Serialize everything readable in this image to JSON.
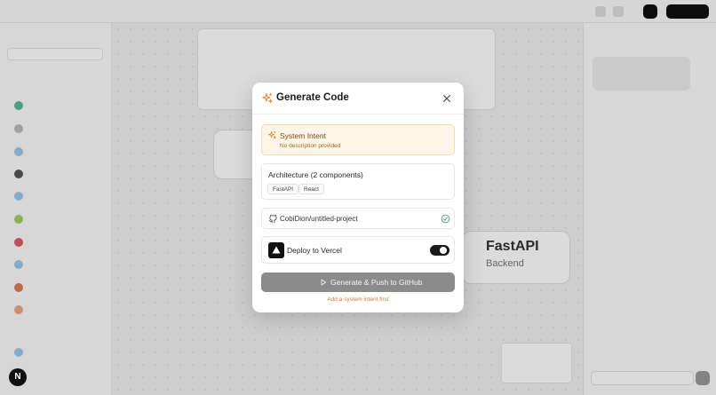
{
  "modal": {
    "title": "Generate Code",
    "system_intent": {
      "title": "System Intent",
      "description": "No description provided"
    },
    "architecture": {
      "title": "Architecture (2 components)",
      "tags": [
        "FastAPI",
        "React"
      ]
    },
    "repository": {
      "name": "CobiDion/untitled-project",
      "connected": true
    },
    "deploy": {
      "label": "Deploy to Vercel",
      "enabled": true
    },
    "generate_button": {
      "label": "Generate & Push to GitHub",
      "disabled": true
    },
    "hint": "Add a system intent first"
  },
  "background": {
    "canvas_node": {
      "title": "FastAPI",
      "subtitle": "Backend"
    },
    "badge": "N"
  },
  "colors": {
    "accent": "#e08a2c",
    "button_disabled": "#8b8b8b",
    "hint": "#d9772b",
    "check": "#3aa57a"
  }
}
